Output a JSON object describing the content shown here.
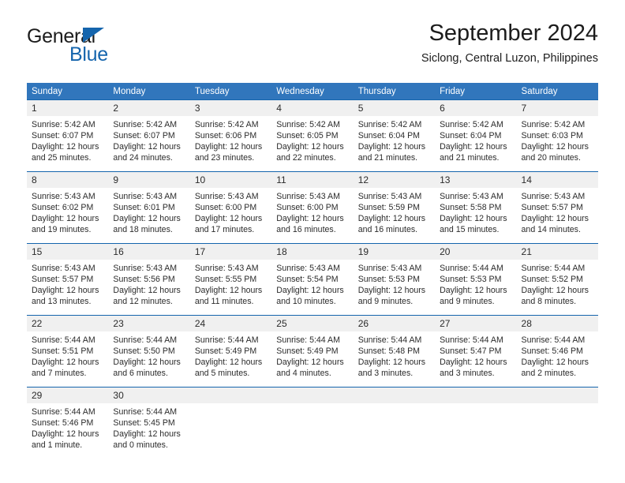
{
  "brand": {
    "name_part1": "General",
    "name_part2": "Blue",
    "accent_color": "#1565ad"
  },
  "header": {
    "title": "September 2024",
    "subtitle": "Siclong, Central Luzon, Philippines"
  },
  "calendar": {
    "header_bg": "#3176bc",
    "daynum_bg": "#f0f0f0",
    "grid_line_color": "#1565ad",
    "weekday_headers": [
      "Sunday",
      "Monday",
      "Tuesday",
      "Wednesday",
      "Thursday",
      "Friday",
      "Saturday"
    ],
    "weeks": [
      [
        {
          "day": "1",
          "sunrise": "Sunrise: 5:42 AM",
          "sunset": "Sunset: 6:07 PM",
          "daylight_line1": "Daylight: 12 hours",
          "daylight_line2": "and 25 minutes."
        },
        {
          "day": "2",
          "sunrise": "Sunrise: 5:42 AM",
          "sunset": "Sunset: 6:07 PM",
          "daylight_line1": "Daylight: 12 hours",
          "daylight_line2": "and 24 minutes."
        },
        {
          "day": "3",
          "sunrise": "Sunrise: 5:42 AM",
          "sunset": "Sunset: 6:06 PM",
          "daylight_line1": "Daylight: 12 hours",
          "daylight_line2": "and 23 minutes."
        },
        {
          "day": "4",
          "sunrise": "Sunrise: 5:42 AM",
          "sunset": "Sunset: 6:05 PM",
          "daylight_line1": "Daylight: 12 hours",
          "daylight_line2": "and 22 minutes."
        },
        {
          "day": "5",
          "sunrise": "Sunrise: 5:42 AM",
          "sunset": "Sunset: 6:04 PM",
          "daylight_line1": "Daylight: 12 hours",
          "daylight_line2": "and 21 minutes."
        },
        {
          "day": "6",
          "sunrise": "Sunrise: 5:42 AM",
          "sunset": "Sunset: 6:04 PM",
          "daylight_line1": "Daylight: 12 hours",
          "daylight_line2": "and 21 minutes."
        },
        {
          "day": "7",
          "sunrise": "Sunrise: 5:42 AM",
          "sunset": "Sunset: 6:03 PM",
          "daylight_line1": "Daylight: 12 hours",
          "daylight_line2": "and 20 minutes."
        }
      ],
      [
        {
          "day": "8",
          "sunrise": "Sunrise: 5:43 AM",
          "sunset": "Sunset: 6:02 PM",
          "daylight_line1": "Daylight: 12 hours",
          "daylight_line2": "and 19 minutes."
        },
        {
          "day": "9",
          "sunrise": "Sunrise: 5:43 AM",
          "sunset": "Sunset: 6:01 PM",
          "daylight_line1": "Daylight: 12 hours",
          "daylight_line2": "and 18 minutes."
        },
        {
          "day": "10",
          "sunrise": "Sunrise: 5:43 AM",
          "sunset": "Sunset: 6:00 PM",
          "daylight_line1": "Daylight: 12 hours",
          "daylight_line2": "and 17 minutes."
        },
        {
          "day": "11",
          "sunrise": "Sunrise: 5:43 AM",
          "sunset": "Sunset: 6:00 PM",
          "daylight_line1": "Daylight: 12 hours",
          "daylight_line2": "and 16 minutes."
        },
        {
          "day": "12",
          "sunrise": "Sunrise: 5:43 AM",
          "sunset": "Sunset: 5:59 PM",
          "daylight_line1": "Daylight: 12 hours",
          "daylight_line2": "and 16 minutes."
        },
        {
          "day": "13",
          "sunrise": "Sunrise: 5:43 AM",
          "sunset": "Sunset: 5:58 PM",
          "daylight_line1": "Daylight: 12 hours",
          "daylight_line2": "and 15 minutes."
        },
        {
          "day": "14",
          "sunrise": "Sunrise: 5:43 AM",
          "sunset": "Sunset: 5:57 PM",
          "daylight_line1": "Daylight: 12 hours",
          "daylight_line2": "and 14 minutes."
        }
      ],
      [
        {
          "day": "15",
          "sunrise": "Sunrise: 5:43 AM",
          "sunset": "Sunset: 5:57 PM",
          "daylight_line1": "Daylight: 12 hours",
          "daylight_line2": "and 13 minutes."
        },
        {
          "day": "16",
          "sunrise": "Sunrise: 5:43 AM",
          "sunset": "Sunset: 5:56 PM",
          "daylight_line1": "Daylight: 12 hours",
          "daylight_line2": "and 12 minutes."
        },
        {
          "day": "17",
          "sunrise": "Sunrise: 5:43 AM",
          "sunset": "Sunset: 5:55 PM",
          "daylight_line1": "Daylight: 12 hours",
          "daylight_line2": "and 11 minutes."
        },
        {
          "day": "18",
          "sunrise": "Sunrise: 5:43 AM",
          "sunset": "Sunset: 5:54 PM",
          "daylight_line1": "Daylight: 12 hours",
          "daylight_line2": "and 10 minutes."
        },
        {
          "day": "19",
          "sunrise": "Sunrise: 5:43 AM",
          "sunset": "Sunset: 5:53 PM",
          "daylight_line1": "Daylight: 12 hours",
          "daylight_line2": "and 9 minutes."
        },
        {
          "day": "20",
          "sunrise": "Sunrise: 5:44 AM",
          "sunset": "Sunset: 5:53 PM",
          "daylight_line1": "Daylight: 12 hours",
          "daylight_line2": "and 9 minutes."
        },
        {
          "day": "21",
          "sunrise": "Sunrise: 5:44 AM",
          "sunset": "Sunset: 5:52 PM",
          "daylight_line1": "Daylight: 12 hours",
          "daylight_line2": "and 8 minutes."
        }
      ],
      [
        {
          "day": "22",
          "sunrise": "Sunrise: 5:44 AM",
          "sunset": "Sunset: 5:51 PM",
          "daylight_line1": "Daylight: 12 hours",
          "daylight_line2": "and 7 minutes."
        },
        {
          "day": "23",
          "sunrise": "Sunrise: 5:44 AM",
          "sunset": "Sunset: 5:50 PM",
          "daylight_line1": "Daylight: 12 hours",
          "daylight_line2": "and 6 minutes."
        },
        {
          "day": "24",
          "sunrise": "Sunrise: 5:44 AM",
          "sunset": "Sunset: 5:49 PM",
          "daylight_line1": "Daylight: 12 hours",
          "daylight_line2": "and 5 minutes."
        },
        {
          "day": "25",
          "sunrise": "Sunrise: 5:44 AM",
          "sunset": "Sunset: 5:49 PM",
          "daylight_line1": "Daylight: 12 hours",
          "daylight_line2": "and 4 minutes."
        },
        {
          "day": "26",
          "sunrise": "Sunrise: 5:44 AM",
          "sunset": "Sunset: 5:48 PM",
          "daylight_line1": "Daylight: 12 hours",
          "daylight_line2": "and 3 minutes."
        },
        {
          "day": "27",
          "sunrise": "Sunrise: 5:44 AM",
          "sunset": "Sunset: 5:47 PM",
          "daylight_line1": "Daylight: 12 hours",
          "daylight_line2": "and 3 minutes."
        },
        {
          "day": "28",
          "sunrise": "Sunrise: 5:44 AM",
          "sunset": "Sunset: 5:46 PM",
          "daylight_line1": "Daylight: 12 hours",
          "daylight_line2": "and 2 minutes."
        }
      ],
      [
        {
          "day": "29",
          "sunrise": "Sunrise: 5:44 AM",
          "sunset": "Sunset: 5:46 PM",
          "daylight_line1": "Daylight: 12 hours",
          "daylight_line2": "and 1 minute."
        },
        {
          "day": "30",
          "sunrise": "Sunrise: 5:44 AM",
          "sunset": "Sunset: 5:45 PM",
          "daylight_line1": "Daylight: 12 hours",
          "daylight_line2": "and 0 minutes."
        },
        {
          "day": "",
          "sunrise": "",
          "sunset": "",
          "daylight_line1": "",
          "daylight_line2": ""
        },
        {
          "day": "",
          "sunrise": "",
          "sunset": "",
          "daylight_line1": "",
          "daylight_line2": ""
        },
        {
          "day": "",
          "sunrise": "",
          "sunset": "",
          "daylight_line1": "",
          "daylight_line2": ""
        },
        {
          "day": "",
          "sunrise": "",
          "sunset": "",
          "daylight_line1": "",
          "daylight_line2": ""
        },
        {
          "day": "",
          "sunrise": "",
          "sunset": "",
          "daylight_line1": "",
          "daylight_line2": ""
        }
      ]
    ]
  }
}
